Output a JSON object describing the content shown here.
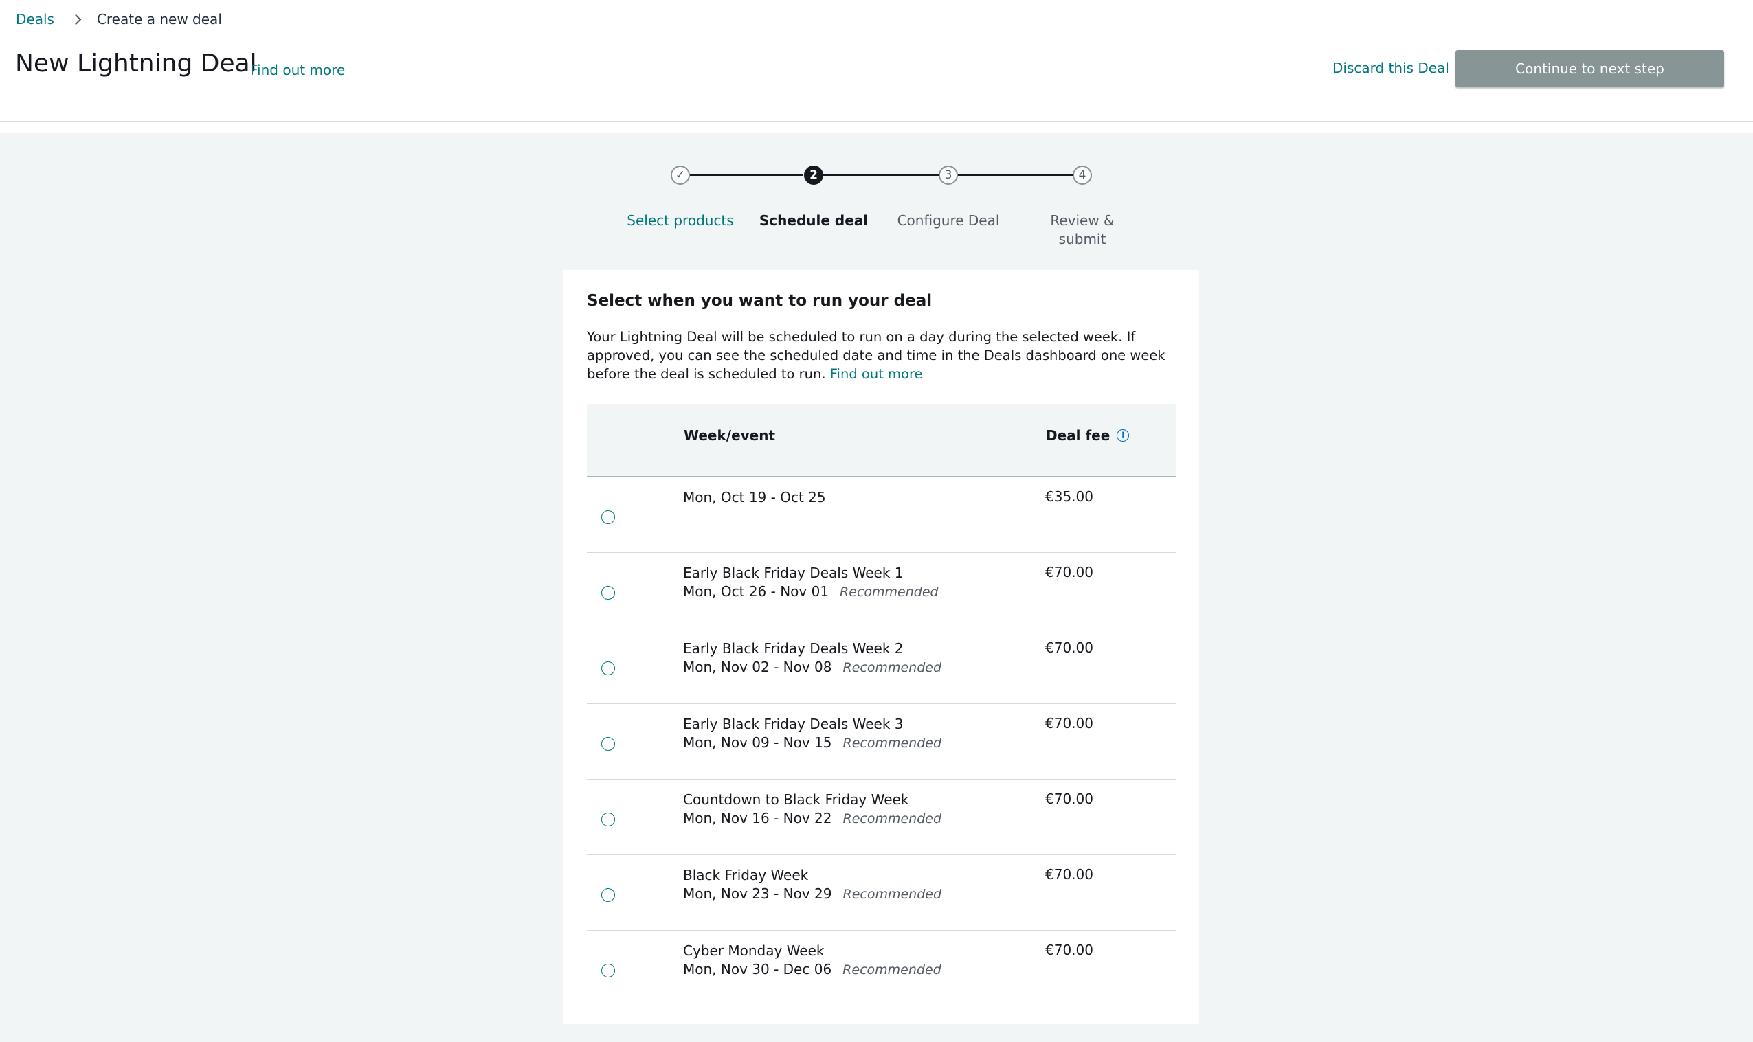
{
  "breadcrumb": {
    "root": "Deals",
    "current": "Create a new deal"
  },
  "header": {
    "title": "New Lightning Deal",
    "find_out_more": "Find out more",
    "discard": "Discard this Deal",
    "continue": "Continue to next step"
  },
  "stepper": {
    "steps": [
      {
        "marker": "✓",
        "label": "Select products",
        "state": "done"
      },
      {
        "marker": "2",
        "label": "Schedule deal",
        "state": "active"
      },
      {
        "marker": "3",
        "label": "Configure Deal",
        "state": "pending"
      },
      {
        "marker": "4",
        "label": "Review & submit",
        "state": "pending"
      }
    ]
  },
  "card": {
    "title": "Select when you want to run your deal",
    "description": "Your Lightning Deal will be scheduled to run on a day during the selected week. If approved, you can see the scheduled date and time in the Deals dashboard one week before the deal is scheduled to run.",
    "description_link": "Find out more"
  },
  "table": {
    "headers": {
      "week": "Week/event",
      "fee": "Deal fee",
      "fee_icon": "info-icon"
    },
    "rows": [
      {
        "event": "",
        "dates": "Mon, Oct 19 - Oct 25",
        "tag": "",
        "fee": "€35.00"
      },
      {
        "event": "Early Black Friday Deals Week 1",
        "dates": "Mon, Oct 26 - Nov 01",
        "tag": "Recommended",
        "fee": "€70.00"
      },
      {
        "event": "Early Black Friday Deals Week 2",
        "dates": "Mon, Nov 02 - Nov 08",
        "tag": "Recommended",
        "fee": "€70.00"
      },
      {
        "event": "Early Black Friday Deals Week 3",
        "dates": "Mon, Nov 09 - Nov 15",
        "tag": "Recommended",
        "fee": "€70.00"
      },
      {
        "event": "Countdown to Black Friday Week",
        "dates": "Mon, Nov 16 - Nov 22",
        "tag": "Recommended",
        "fee": "€70.00"
      },
      {
        "event": "Black Friday Week",
        "dates": "Mon, Nov 23 - Nov 29",
        "tag": "Recommended",
        "fee": "€70.00"
      },
      {
        "event": "Cyber Monday Week",
        "dates": "Mon, Nov 30 - Dec 06",
        "tag": "Recommended",
        "fee": "€70.00"
      }
    ]
  },
  "colors": {
    "link": "#00787d",
    "button_disabled": "#879596",
    "page_bg": "#f2f5f6",
    "text": "#16191f"
  }
}
